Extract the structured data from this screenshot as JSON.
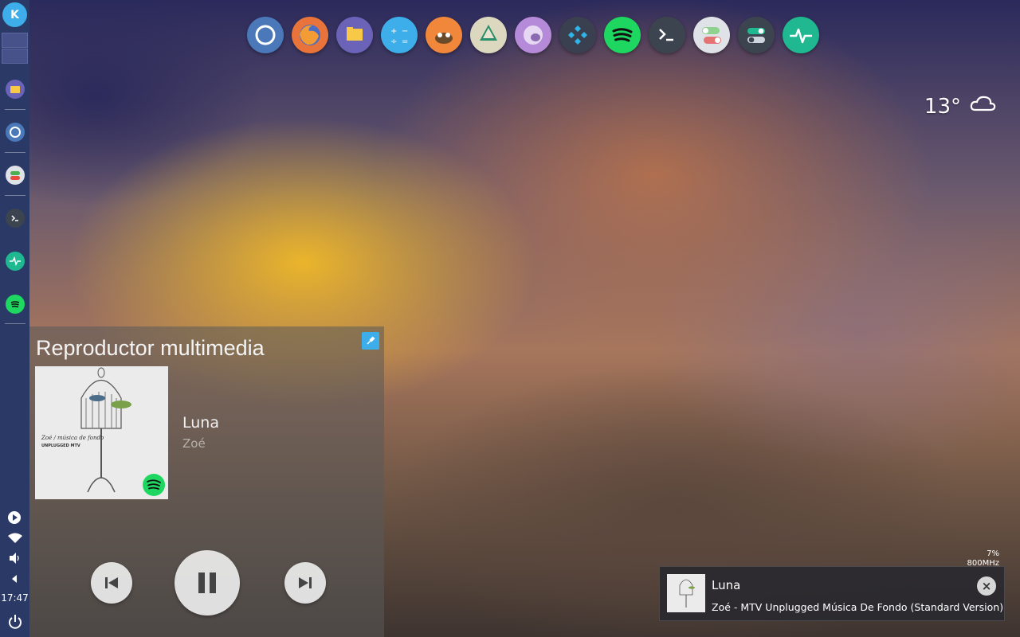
{
  "dock": {
    "apps": [
      {
        "name": "chromium",
        "color": "#4a78b8"
      },
      {
        "name": "firefox",
        "color": "#e8743b"
      },
      {
        "name": "files",
        "color": "#6a63b8"
      },
      {
        "name": "calculator",
        "color": "#3daee9"
      },
      {
        "name": "gimp",
        "color": "#f0873a"
      },
      {
        "name": "inkscape",
        "color": "#dcd8c0"
      },
      {
        "name": "paint",
        "color": "#b58ad8"
      },
      {
        "name": "kodi",
        "color": "#3a4050"
      },
      {
        "name": "spotify",
        "color": "#1ed760"
      },
      {
        "name": "terminal",
        "color": "#3c4450"
      },
      {
        "name": "toggle-settings",
        "color": "#dfe3e7"
      },
      {
        "name": "system-settings",
        "color": "#3c4450"
      },
      {
        "name": "system-monitor",
        "color": "#1fb890"
      }
    ]
  },
  "weather": {
    "temperature": "13°",
    "icon": "cloud-icon"
  },
  "player": {
    "title": "Reproductor multimedia",
    "track": "Luna",
    "artist": "Zoé",
    "album_art_text": "Zoé / música de fondo",
    "album_art_sub": "UNPLUGGED MTV"
  },
  "notification": {
    "title": "Luna",
    "body": "Zoé - MTV Unplugged Música De Fondo (Standard Version)",
    "close": "×"
  },
  "cpu": {
    "percent": "7%",
    "freq": "800MHz"
  },
  "panel": {
    "clock": "17:47"
  },
  "colors": {
    "accent": "#3daee9",
    "panel": "#2b3966",
    "spotify": "#1ed760"
  }
}
